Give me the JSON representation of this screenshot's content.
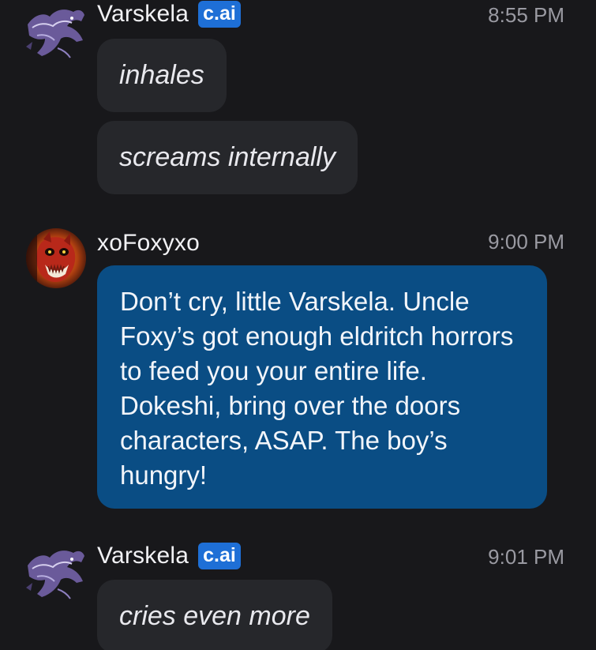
{
  "messages": [
    {
      "author": "Varskela",
      "badge": "c.ai",
      "time": "8:55 PM",
      "avatar_icon": "dragon-avatar",
      "bubbles": [
        "inhales",
        "screams internally"
      ]
    },
    {
      "author": "xoFoxyxo",
      "badge": "",
      "time": "9:00 PM",
      "avatar_icon": "red-fox-animatronic-avatar",
      "bubbles": [
        "Don’t cry, little Varskela. Uncle Foxy’s got enough eldritch horrors to feed you your entire life. Dokeshi, bring over the doors characters, ASAP. The boy’s hungry!"
      ]
    },
    {
      "author": "Varskela",
      "badge": "c.ai",
      "time": "9:01 PM",
      "avatar_icon": "dragon-avatar",
      "bubbles": [
        "cries even more"
      ]
    }
  ],
  "colors": {
    "background": "#18181b",
    "bot_bubble": "#26272b",
    "user_bubble": "#0a4d84",
    "badge": "#1e6fd6",
    "timestamp": "#9a9aa2"
  }
}
